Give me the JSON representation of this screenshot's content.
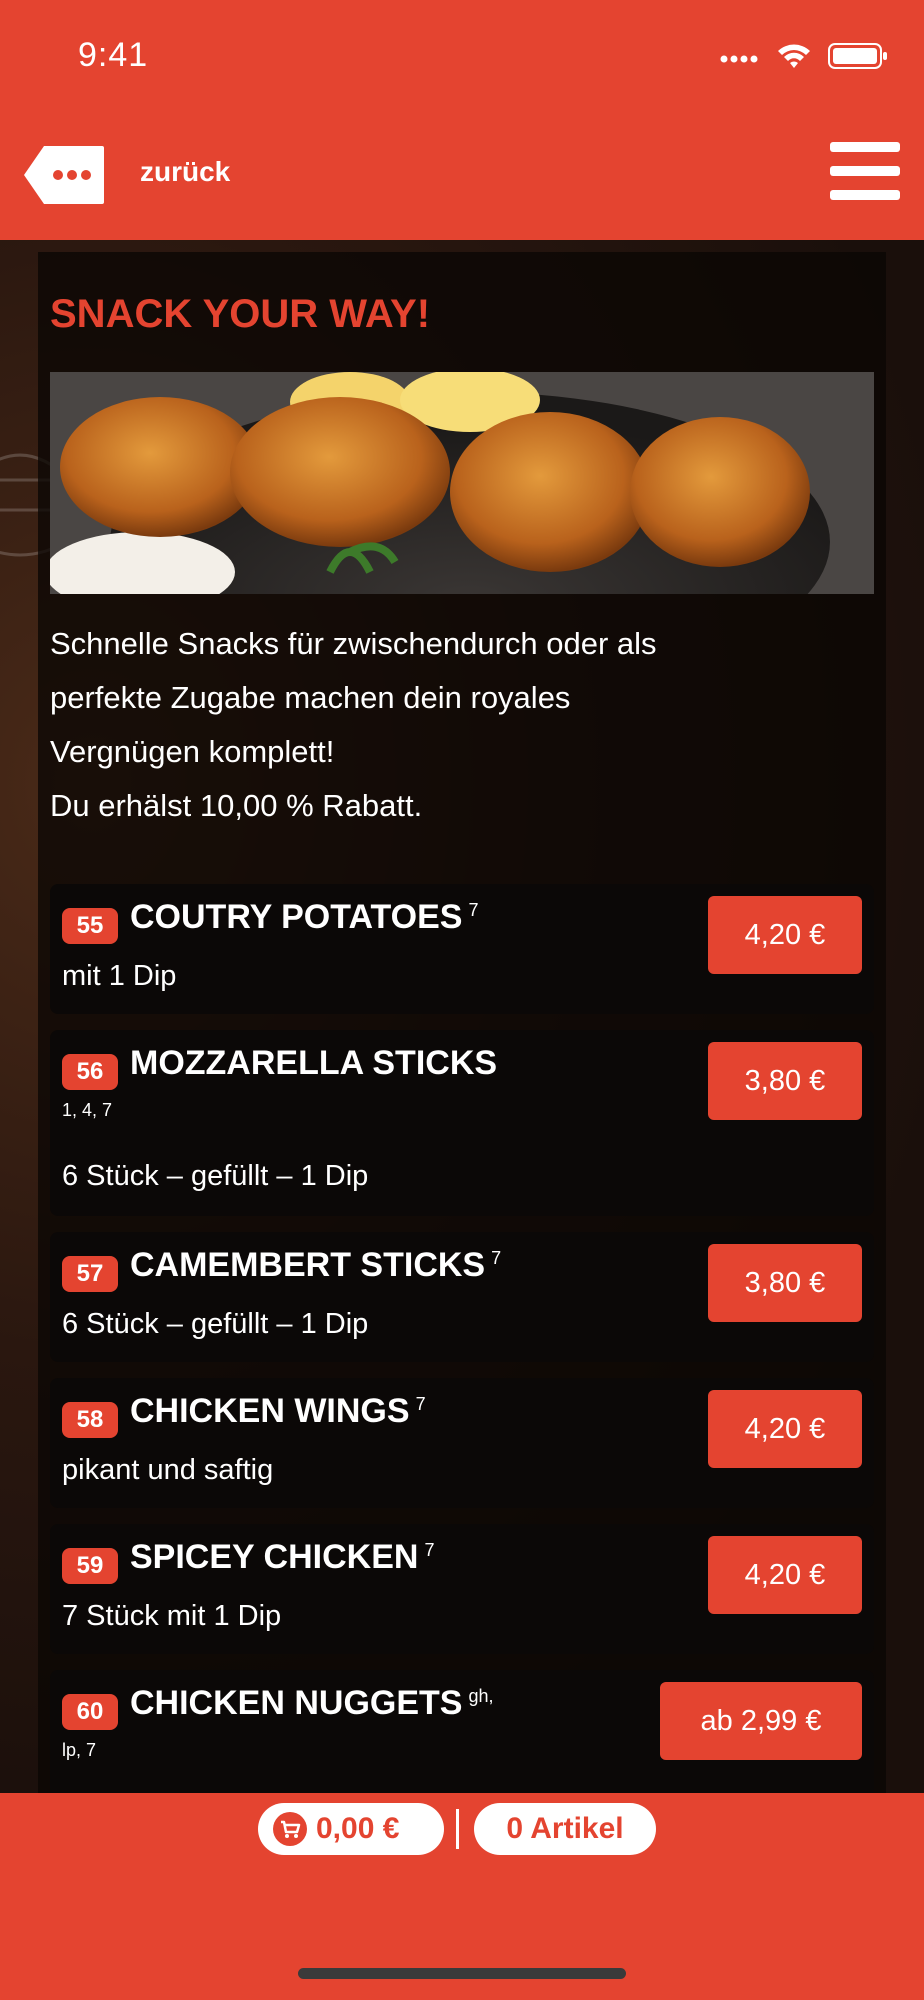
{
  "status": {
    "time": "9:41"
  },
  "nav": {
    "back_label": "zurück"
  },
  "page": {
    "headline": "SNACK YOUR WAY!",
    "intro_lines": [
      "Schnelle Snacks für zwischendurch oder als",
      "perfekte Zugabe machen dein royales",
      "Vergnügen komplett!",
      "Du erhälst 10,00 % Rabatt."
    ]
  },
  "items": [
    {
      "number": "55",
      "name": "COUTRY POTATOES",
      "sup": "7",
      "footnote": "",
      "desc": "mit 1 Dip",
      "price": "4,20 €"
    },
    {
      "number": "56",
      "name": "MOZZARELLA STICKS",
      "sup": "",
      "footnote": "1, 4, 7",
      "desc": "6 Stück – gefüllt – 1 Dip",
      "price": "3,80 €"
    },
    {
      "number": "57",
      "name": "CAMEMBERT STICKS",
      "sup": "7",
      "footnote": "",
      "desc": "6 Stück – gefüllt – 1 Dip",
      "price": "3,80 €"
    },
    {
      "number": "58",
      "name": "CHICKEN WINGS",
      "sup": "7",
      "footnote": "",
      "desc": "pikant und saftig",
      "price": "4,20 €"
    },
    {
      "number": "59",
      "name": "SPICEY CHICKEN",
      "sup": "7",
      "footnote": "",
      "desc": "7 Stück mit 1 Dip",
      "price": "4,20 €"
    },
    {
      "number": "60",
      "name": "CHICKEN NUGGETS",
      "sup": "gh,",
      "footnote": "lp, 7",
      "desc": "",
      "price": "ab 2,99 €"
    }
  ],
  "cart": {
    "total": "0,00 €",
    "items_label": "0 Artikel"
  },
  "colors": {
    "accent": "#e44430",
    "background": "#1a0f0b"
  }
}
